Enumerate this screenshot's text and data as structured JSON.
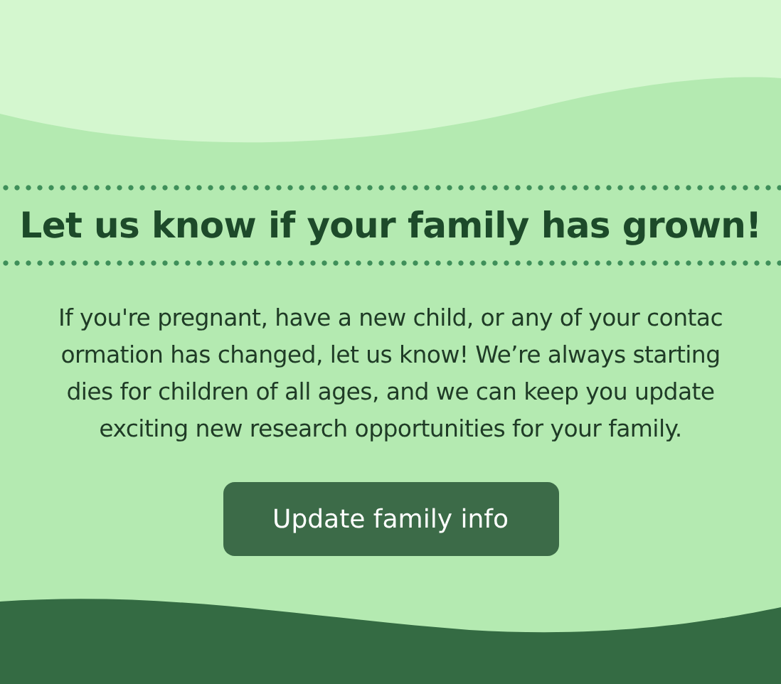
{
  "heading": "Let us know if your family has grown!",
  "paragraph_lines": [
    "If you're pregnant, have a new child, or any of your contac",
    "ormation has changed, let us know! We’re always starting",
    "dies for children of all ages, and we can keep you update",
    "exciting new research opportunities for your family."
  ],
  "button": {
    "label": "Update family info"
  }
}
